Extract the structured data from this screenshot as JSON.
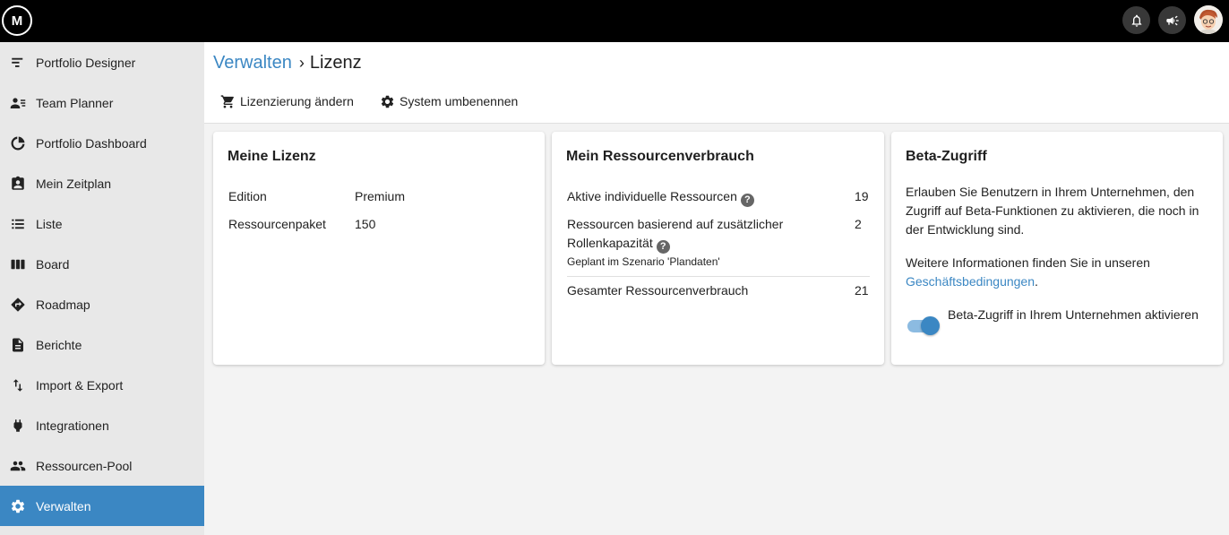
{
  "app": {
    "logo_text": "M"
  },
  "topbar": {
    "icons": [
      "bell-icon",
      "megaphone-icon",
      "user-avatar"
    ]
  },
  "sidebar": {
    "items": [
      {
        "label": "Portfolio Designer",
        "icon": "portfolio-designer-icon"
      },
      {
        "label": "Team Planner",
        "icon": "team-planner-icon"
      },
      {
        "label": "Portfolio Dashboard",
        "icon": "dashboard-icon"
      },
      {
        "label": "Mein Zeitplan",
        "icon": "schedule-icon"
      },
      {
        "label": "Liste",
        "icon": "list-icon"
      },
      {
        "label": "Board",
        "icon": "board-icon"
      },
      {
        "label": "Roadmap",
        "icon": "roadmap-icon"
      },
      {
        "label": "Berichte",
        "icon": "report-icon"
      },
      {
        "label": "Import & Export",
        "icon": "import-export-icon"
      },
      {
        "label": "Integrationen",
        "icon": "plug-icon"
      },
      {
        "label": "Ressourcen-Pool",
        "icon": "people-icon"
      },
      {
        "label": "Verwalten",
        "icon": "gear-icon",
        "active": true
      }
    ]
  },
  "breadcrumb": {
    "parent": "Verwalten",
    "separator": "›",
    "current": "Lizenz"
  },
  "actions": {
    "change_license": "Lizenzierung ändern",
    "rename_system": "System umbenennen"
  },
  "license_card": {
    "title": "Meine Lizenz",
    "rows": [
      {
        "label": "Edition",
        "value": "Premium"
      },
      {
        "label": "Ressourcenpaket",
        "value": "150"
      }
    ]
  },
  "resource_card": {
    "title": "Mein Ressourcenverbrauch",
    "active_label": "Aktive individuelle Ressourcen",
    "active_value": "19",
    "role_label_line1": "Ressourcen basierend auf zusätzlicher",
    "role_label_line2": "Rollenkapazität",
    "role_value": "2",
    "role_note": "Geplant im Szenario 'Plandaten'",
    "total_label": "Gesamter Ressourcenverbrauch",
    "total_value": "21"
  },
  "beta_card": {
    "title": "Beta-Zugriff",
    "description": "Erlauben Sie Benutzern in Ihrem Unternehmen, den Zugriff auf Beta-Funktionen zu aktivieren, die noch in der Entwicklung sind.",
    "info_prefix": "Weitere Informationen finden Sie in unseren ",
    "info_link": "Geschäftsbedingungen",
    "info_suffix": ".",
    "toggle_label": "Beta-Zugriff in Ihrem Unternehmen aktivieren",
    "toggle_on": true
  },
  "colors": {
    "accent": "#3b87c3",
    "topbar": "#000000",
    "sidebar": "#e8e8e8"
  }
}
